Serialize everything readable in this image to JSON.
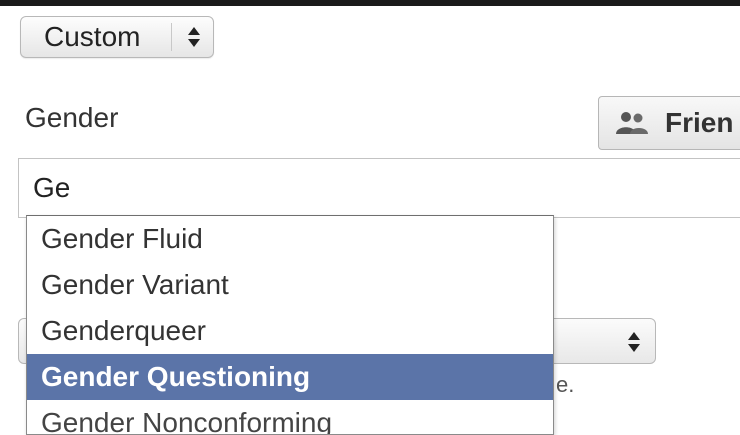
{
  "privacy_dropdown": {
    "label": "Custom",
    "icon": "updown-arrows-icon"
  },
  "gender_section": {
    "label": "Gender",
    "input_value": "Ge"
  },
  "audience_button": {
    "label": "Frien",
    "icon": "people-icon"
  },
  "suggestions": {
    "items": [
      {
        "label": "Gender Fluid"
      },
      {
        "label": "Gender Variant"
      },
      {
        "label": "Genderqueer"
      },
      {
        "label": "Gender Questioning"
      },
      {
        "label": "Gender Nonconforming"
      }
    ],
    "selected_item": "Gender Questioning"
  },
  "partial_text": "e.",
  "colors": {
    "highlight": "#5b74a8",
    "highlight_text": "#ffffff",
    "text": "#333333",
    "border": "#b8b8b8"
  }
}
